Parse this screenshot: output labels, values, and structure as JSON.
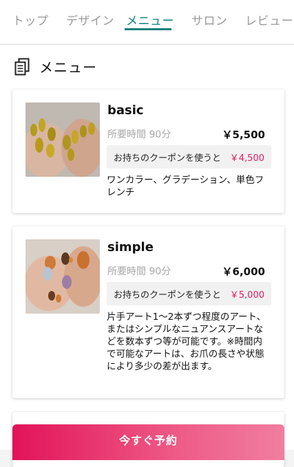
{
  "tabs": [
    {
      "label": "トップ",
      "active": false
    },
    {
      "label": "デザイン",
      "active": false
    },
    {
      "label": "メニュー",
      "active": true
    },
    {
      "label": "サロン",
      "active": false
    },
    {
      "label": "レビュー",
      "active": false
    }
  ],
  "accent_color": "#0f7f7a",
  "coupon_price_color": "#e5195c",
  "section": {
    "title": "メニュー",
    "icon": "document-copy-icon"
  },
  "menus": [
    {
      "title": "basic",
      "time": "所要時間 90分",
      "price": "￥5,500",
      "coupon_label": "お持ちのクーポンを使うと",
      "coupon_price": "￥4,500",
      "description": "ワンカラー、グラデーション、単色フレンチ",
      "image": "gold-glitter-nails-photo"
    },
    {
      "title": "simple",
      "time": "所要時間 90分",
      "price": "￥6,000",
      "coupon_label": "お持ちのクーポンを使うと",
      "coupon_price": "￥5,000",
      "description": "片手アート1〜2本ずつ程度のアート、またはシンプルなニュアンスアートなどを数本ずつ等が可能です。※時間内で可能なアートは、お爪の長さや状態により多少の差が出ます。",
      "image": "orange-nuance-nails-photo"
    }
  ],
  "reserve_button": "今すぐ予約"
}
